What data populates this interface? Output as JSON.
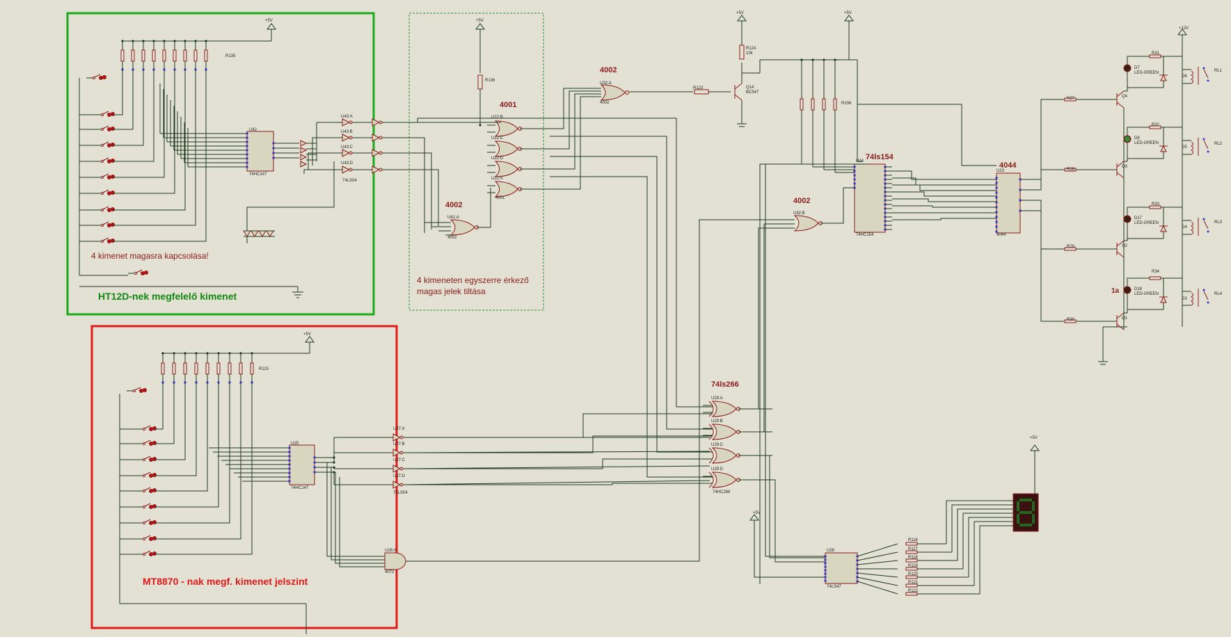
{
  "colors": {
    "background": "#e2e1d3",
    "wire": "#1f3a1f",
    "component": "#8b1a1a",
    "ic_fill": "#d9d6c0",
    "green_frame": "#1aaa1a",
    "red_frame": "#e01818",
    "dashed_frame": "#2f8f2f",
    "text_red": "#8b1a1a",
    "text_green": "#118811"
  },
  "section_labels": {
    "green_title": "HT12D-nek megfelelő kimenet",
    "green_note": "4 kimenet magasra kapcsolása!",
    "dashed_line1": "4 kimeneten egyszerre érkező",
    "dashed_line2": "magas jelek tiltása",
    "red_title": "MT8870 - nak megf. kimenet jelszint"
  },
  "chip_titles": {
    "or_top": "4002",
    "nor_4001": "4001",
    "nor_4002_left": "4002",
    "nor_4002_mid": "4002",
    "ls154": "74ls154",
    "c4044": "4044",
    "ls266": "74ls266"
  },
  "parts": {
    "U42": "U42",
    "U42_type": "74HC147",
    "U25": "U25",
    "U25_type": "74HC147",
    "U43A": "U43:A",
    "U43B": "U43:B",
    "U43C": "U43:C",
    "U43D": "U43:D",
    "U43_type": "74LS04",
    "U22B": "U22:B",
    "U22C": "U22:C",
    "U22D": "U22:D",
    "U22A": "U22:A",
    "U22_type": "4001",
    "U41A": "U41:A",
    "U41_type": "4002",
    "U32A": "U32:A",
    "U32B": "U32:B",
    "U32_type": "4002",
    "U24": "U24",
    "U24_type": "74HC154",
    "U23": "U23",
    "U23_type": "4044",
    "U29A": "U29:A",
    "U29B": "U29:B",
    "U29C": "U29:C",
    "U29D": "U29:D",
    "U29_type": "74HC266",
    "U27A": "U27:A",
    "U27B": "U27:B",
    "U27C": "U27:C",
    "U27D": "U27:D",
    "U27_type": "74LS04",
    "U28A": "U28:A",
    "U28_type": "4072",
    "U26": "U26",
    "U26_type": "74LS47",
    "R136": "R136",
    "R123": "R123",
    "R124": "R124",
    "R135": "R135",
    "R115": "R115",
    "R106": "R106",
    "Q14": "Q14",
    "Q14_type": "BC547",
    "R27": "R27",
    "R28": "R28",
    "R29": "R29",
    "R30": "R30",
    "R31": "R31",
    "R32": "R32",
    "R33": "R33",
    "R34": "R34",
    "Q4": "Q4",
    "Q3": "Q3",
    "Q2": "Q2",
    "Q1": "Q1",
    "D7": "D7",
    "D8": "D8",
    "D17": "D17",
    "D18": "D18",
    "D6": "D6",
    "D5": "D5",
    "D4": "D4",
    "D3": "D3",
    "RL1": "RL1",
    "RL2": "RL2",
    "RL3": "RL3",
    "RL4": "RL4",
    "R116": "R116",
    "R117": "R117",
    "R118": "R118",
    "R119": "R119",
    "R120": "R120",
    "R121": "R121",
    "R122": "R122",
    "led_green": "LED-GREEN",
    "diode": "1N4148",
    "bjt": "BC547",
    "res_1k": "1k",
    "res_10k": "10k",
    "res_470": "470",
    "relay_v": "12V",
    "label_1a": "1a"
  },
  "power": {
    "p5v": "+5V",
    "p12v": "+12V"
  }
}
